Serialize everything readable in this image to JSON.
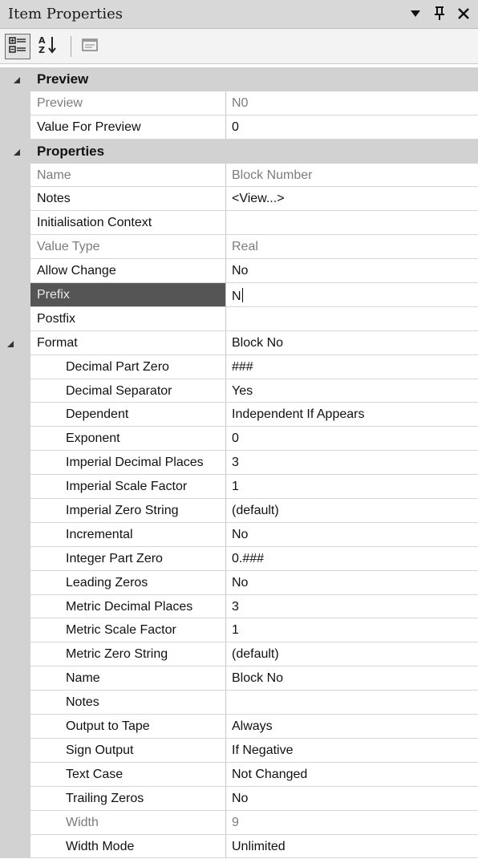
{
  "window": {
    "title": "Item Properties",
    "dropdown_icon": "dropdown-arrow-icon",
    "pin_icon": "pin-icon",
    "close_icon": "close-icon"
  },
  "toolbar": {
    "buttons": [
      {
        "icon": "categorized-view-icon",
        "active": true
      },
      {
        "icon": "sort-alphabetical-icon",
        "active": false
      },
      {
        "icon": "property-pages-icon",
        "active": false
      }
    ]
  },
  "grid": {
    "categories": {
      "preview": {
        "label": "Preview"
      },
      "properties": {
        "label": "Properties"
      }
    },
    "preview_rows": [
      {
        "name": "Preview",
        "value": "N0"
      },
      {
        "name": "Value For Preview",
        "value": "0"
      }
    ],
    "properties_rows": [
      {
        "name": "Name",
        "value": "Block Number"
      },
      {
        "name": "Notes",
        "value": "<View...>"
      },
      {
        "name": "Initialisation Context",
        "value": ""
      },
      {
        "name": "Value Type",
        "value": "Real"
      },
      {
        "name": "Allow Change",
        "value": "No"
      },
      {
        "name": "Prefix",
        "value": "N"
      },
      {
        "name": "Postfix",
        "value": ""
      }
    ],
    "format": {
      "name": "Format",
      "value": "Block No"
    },
    "format_rows": [
      {
        "name": "Decimal Part Zero",
        "value": "###"
      },
      {
        "name": "Decimal Separator",
        "value": "Yes"
      },
      {
        "name": "Dependent",
        "value": "Independent If Appears"
      },
      {
        "name": "Exponent",
        "value": "0"
      },
      {
        "name": "Imperial Decimal Places",
        "value": "3"
      },
      {
        "name": "Imperial Scale Factor",
        "value": "1"
      },
      {
        "name": "Imperial Zero String",
        "value": "(default)"
      },
      {
        "name": "Incremental",
        "value": "No"
      },
      {
        "name": "Integer Part Zero",
        "value": "0.###"
      },
      {
        "name": "Leading Zeros",
        "value": "No"
      },
      {
        "name": "Metric Decimal Places",
        "value": "3"
      },
      {
        "name": "Metric Scale Factor",
        "value": "1"
      },
      {
        "name": "Metric Zero String",
        "value": "(default)"
      },
      {
        "name": "Name",
        "value": "Block No"
      },
      {
        "name": "Notes",
        "value": ""
      },
      {
        "name": "Output to Tape",
        "value": "Always"
      },
      {
        "name": "Sign Output",
        "value": "If Negative"
      },
      {
        "name": "Text Case",
        "value": "Not Changed"
      },
      {
        "name": "Trailing Zeros",
        "value": "No"
      },
      {
        "name": "Width",
        "value": "9"
      },
      {
        "name": "Width Mode",
        "value": "Unlimited"
      }
    ]
  }
}
